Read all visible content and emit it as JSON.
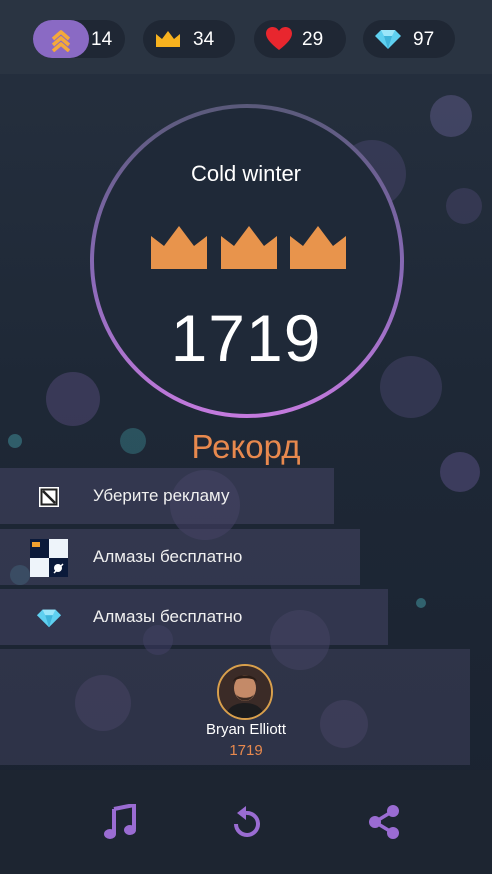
{
  "header": {
    "stats": [
      {
        "icon": "level-chevrons-icon",
        "value": "14"
      },
      {
        "icon": "crown-icon",
        "value": "34"
      },
      {
        "icon": "heart-icon",
        "value": "29"
      },
      {
        "icon": "diamond-icon",
        "value": "97"
      }
    ]
  },
  "result": {
    "song_title": "Cold winter",
    "crowns_earned": 3,
    "crowns_total": 3,
    "score": "1719",
    "record_label": "Рекорд"
  },
  "menu": {
    "items": [
      {
        "label": "Уберите рекламу",
        "icon": "no-ads-icon"
      },
      {
        "label": "Алмазы бесплатно",
        "icon": "piano-tiles-app-icon"
      },
      {
        "label": "Алмазы бесплатно",
        "icon": "diamond-icon"
      }
    ]
  },
  "leaderboard": {
    "player_name": "Bryan Elliott",
    "player_score": "1719"
  },
  "footer": {
    "buttons": [
      "music-icon",
      "replay-icon",
      "share-icon"
    ]
  },
  "colors": {
    "accent_purple": "#8a6ac4",
    "crown_orange": "#e8944c",
    "record_orange": "#e8894e",
    "heart_red": "#e8262e",
    "diamond_cyan": "#5fd0f0",
    "crown_yellow": "#f7b21f"
  }
}
